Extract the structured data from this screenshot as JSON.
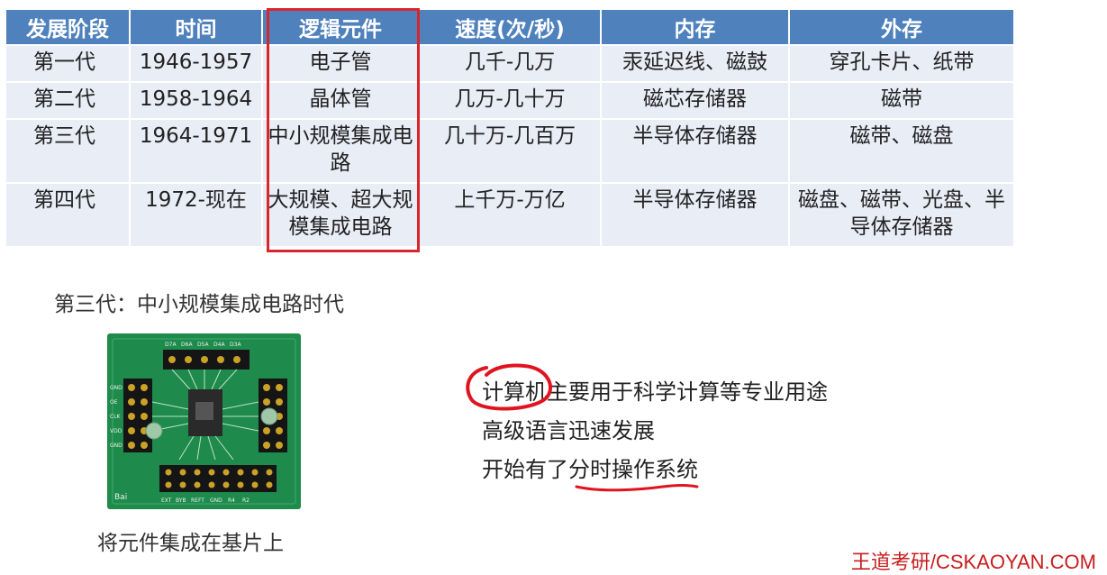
{
  "table": {
    "headers": [
      "发展阶段",
      "时间",
      "逻辑元件",
      "速度(次/秒)",
      "内存",
      "外存"
    ],
    "rows": [
      [
        "第一代",
        "1946-1957",
        "电子管",
        "几千-几万",
        "汞延迟线、磁鼓",
        "穿孔卡片、纸带"
      ],
      [
        "第二代",
        "1958-1964",
        "晶体管",
        "几万-几十万",
        "磁芯存储器",
        "磁带"
      ],
      [
        "第三代",
        "1964-1971",
        "中小规模集成电路",
        "几十万-几百万",
        "半导体存储器",
        "磁带、磁盘"
      ],
      [
        "第四代",
        "1972-现在",
        "大规模、超大规模集成电路",
        "上千万-万亿",
        "半导体存储器",
        "磁盘、磁带、光盘、半导体存储器"
      ]
    ],
    "highlight_color": "#d9262c",
    "header_color": "#4f81bd"
  },
  "section_title": "第三代：中小规模集成电路时代",
  "figure": {
    "caption": "将元件集成在基片上",
    "board_color": "#1e8a4c",
    "pin_labels_top": [
      "D7A",
      "D6A",
      "D5A",
      "D4A",
      "D3A"
    ],
    "pin_labels_bottom": [
      "EXT",
      "BYB",
      "REFT",
      "GND",
      "R4",
      "R2"
    ],
    "pin_labels_left": [
      "GND",
      "OE",
      "CLK",
      "VDD",
      "GND"
    ],
    "logo_text": "Bai"
  },
  "bullets": [
    "计算机主要用于科学计算等专业用途",
    "高级语言迅速发展",
    "开始有了分时操作系统"
  ],
  "annotation_color": "#e0141e",
  "watermark": "王道考研/CSKAOYAN.COM"
}
